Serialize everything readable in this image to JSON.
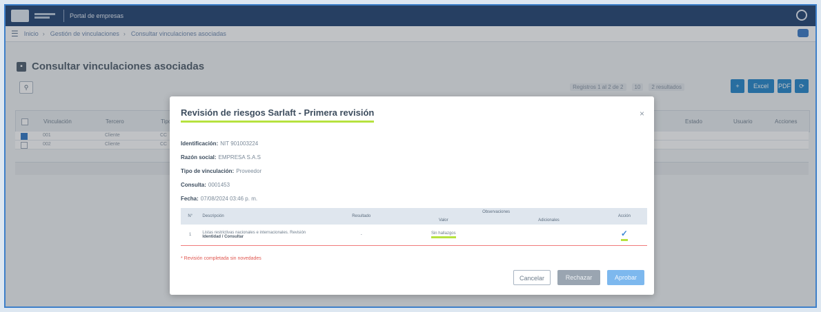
{
  "header": {
    "app_title": "Portal de empresas"
  },
  "breadcrumb": {
    "menu_icon": "hamburger-icon",
    "items": [
      "Inicio",
      "Gestión de vinculaciones",
      "Consultar vinculaciones asociadas"
    ]
  },
  "page": {
    "title": "Consultar vinculaciones asociadas",
    "filter_icon": "filter-icon",
    "pager": {
      "range": "Registros 1 al 2 de 2",
      "page_size": "10",
      "results": "2 resultados"
    },
    "toolbar": [
      "+",
      "Excel",
      "PDF",
      "⟳"
    ],
    "table": {
      "columns": [
        "Vinculación",
        "Tercero",
        "Tipo",
        "Estado",
        "Usuario",
        "Acciones"
      ],
      "rows": [
        {
          "col1": "001",
          "col2": "Cliente",
          "col3": "CC",
          "checked": true
        },
        {
          "col1": "002",
          "col2": "Cliente",
          "col3": "CC",
          "checked": false
        }
      ]
    }
  },
  "modal": {
    "title": "Revisión de riesgos Sarlaft - Primera revisión",
    "close_label": "×",
    "fields": [
      {
        "label": "Identificación:",
        "value": "NIT 901003224"
      },
      {
        "label": "Razón social:",
        "value": "EMPRESA S.A.S"
      },
      {
        "label": "Tipo de vinculación:",
        "value": "Proveedor"
      },
      {
        "label": "Consulta:",
        "value": "0001453"
      },
      {
        "label": "Fecha:",
        "value": "07/08/2024 03:46 p. m."
      }
    ],
    "table": {
      "headers": {
        "num": "N°",
        "description": "Descripción",
        "resultado": "Resultado",
        "group": "Observaciones",
        "valor": "Valor",
        "adicionales": "Adicionales",
        "accion": "Acción"
      },
      "row": {
        "num": "1",
        "description": "Listas restrictivas nacionales e internacionales. Revisión",
        "description_sub": "Identidad / Consultar",
        "resultado": "-",
        "valor": "Sin hallazgos",
        "adicionales": "",
        "accion_icon": "check-icon"
      }
    },
    "validation": "* Revisión completada sin novedades",
    "buttons": {
      "cancel": "Cancelar",
      "reject": "Rechazar",
      "approve": "Aprobar"
    }
  },
  "colors": {
    "header_bg": "#1d3e6e",
    "accent_blue": "#1f84c9",
    "highlight_green": "#b6e23f",
    "error_red": "#e0564f"
  }
}
